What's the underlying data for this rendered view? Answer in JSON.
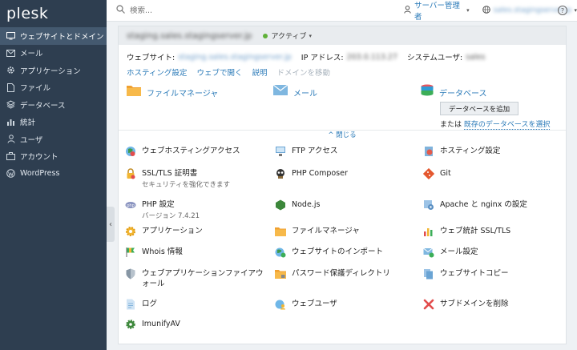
{
  "app": {
    "logo": "plesk"
  },
  "sidebar": {
    "items": [
      {
        "label": "ウェブサイトとドメイン",
        "icon": "monitor-icon"
      },
      {
        "label": "メール",
        "icon": "mail-icon"
      },
      {
        "label": "アプリケーション",
        "icon": "gear-icon"
      },
      {
        "label": "ファイル",
        "icon": "file-icon"
      },
      {
        "label": "データベース",
        "icon": "database-icon"
      },
      {
        "label": "統計",
        "icon": "bar-chart-icon"
      },
      {
        "label": "ユーザ",
        "icon": "user-icon"
      },
      {
        "label": "アカウント",
        "icon": "account-icon"
      },
      {
        "label": "WordPress",
        "icon": "wordpress-icon"
      }
    ],
    "toggle": "‹"
  },
  "topbar": {
    "search_placeholder": "検索...",
    "admin_label": "サーバー管理者",
    "domain": "sales.stagingserver.jp",
    "help": "?"
  },
  "domain_card": {
    "name": "staging.sales.stagingserver.jp",
    "status": "アクティブ",
    "website_label": "ウェブサイト:",
    "website_value": "staging.sales.stagingserver.jp",
    "ip_label": "IP アドレス:",
    "ip_value": "203.0.113.27",
    "sysuser_label": "システムユーザ:",
    "sysuser_value": "sales",
    "links": {
      "hosting": "ホスティング設定",
      "open": "ウェブで開く",
      "description": "説明",
      "move": "ドメインを移動"
    },
    "quick": {
      "file_manager": "ファイルマネージャ",
      "mail": "メール",
      "database": "データベース",
      "add_db_button": "データベースを追加",
      "or_text": "または",
      "select_existing": "既存のデータベースを選択"
    },
    "collapse": "^ 閉じる",
    "tools": [
      {
        "label": "ウェブホスティングアクセス"
      },
      {
        "label": "FTP アクセス"
      },
      {
        "label": "ホスティング設定"
      },
      {
        "label": "SSL/TLS 証明書",
        "desc": "セキュリティを強化できます"
      },
      {
        "label": "PHP Composer"
      },
      {
        "label": "Git"
      },
      {
        "label": "PHP 設定",
        "desc": "バージョン 7.4.21"
      },
      {
        "label": "Node.js"
      },
      {
        "label": "Apache と nginx の設定"
      },
      {
        "label": "アプリケーション"
      },
      {
        "label": "ファイルマネージャ"
      },
      {
        "label": "ウェブ統計 SSL/TLS"
      },
      {
        "label": "Whois 情報"
      },
      {
        "label": "ウェブサイトのインポート"
      },
      {
        "label": "メール設定"
      },
      {
        "label": "ウェブアプリケーションファイアウォール"
      },
      {
        "label": "パスワード保護ディレクトリ"
      },
      {
        "label": "ウェブサイトコピー"
      },
      {
        "label": "ログ"
      },
      {
        "label": "ウェブユーザ"
      },
      {
        "label": "サブドメインを削除"
      },
      {
        "label": "ImunifyAV"
      }
    ]
  }
}
